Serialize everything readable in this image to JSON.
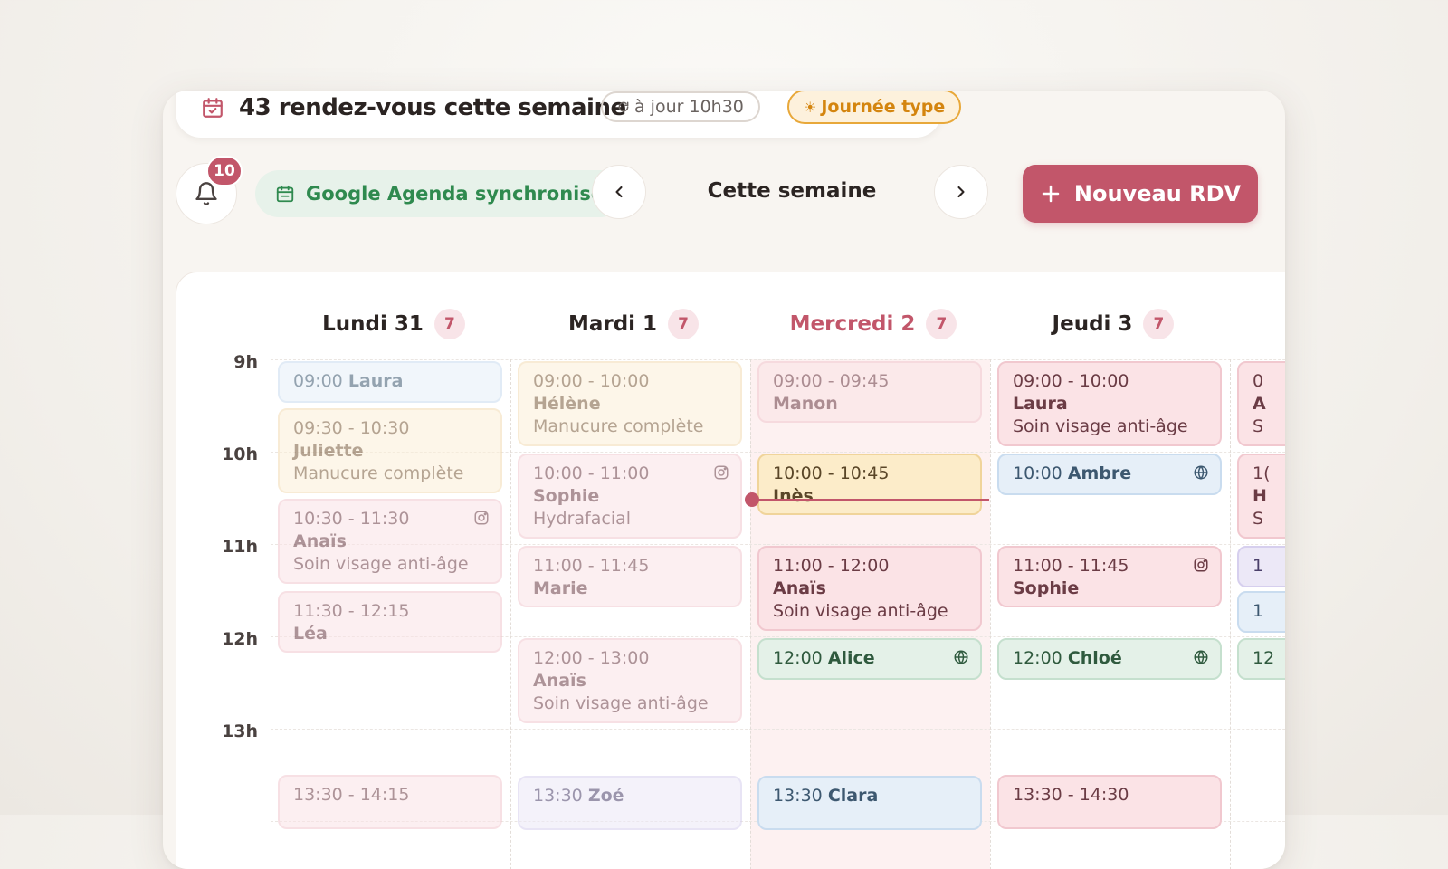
{
  "header": {
    "title": "43 rendez-vous cette semaine",
    "updated": "à jour 10h30",
    "day_type": "Journée type"
  },
  "toolbar": {
    "notifications_count": "10",
    "sync_label": "Google Agenda synchronisé",
    "week_label": "Cette semaine",
    "new_button": "Nouveau RDV"
  },
  "hours": [
    "9h",
    "10h",
    "11h",
    "12h",
    "13h"
  ],
  "days": [
    {
      "label": "Lundi 31",
      "count": "7"
    },
    {
      "label": "Mardi 1",
      "count": "7"
    },
    {
      "label": "Mercredi 2",
      "count": "7"
    },
    {
      "label": "Jeudi 3",
      "count": "7"
    }
  ],
  "events": {
    "mon": [
      {
        "time": "09:00",
        "name": "Laura"
      },
      {
        "time": "09:30 - 10:30",
        "name": "Juliette",
        "service": "Manucure complète"
      },
      {
        "time": "10:30 - 11:30",
        "name": "Anaïs",
        "service": "Soin visage anti-âge",
        "icon": "instagram-icon"
      },
      {
        "time": "11:30 - 12:15",
        "name": "Léa"
      },
      {
        "time": "13:30 - 14:15"
      }
    ],
    "tue": [
      {
        "time": "09:00 - 10:00",
        "name": "Hélène",
        "service": "Manucure complète"
      },
      {
        "time": "10:00 - 11:00",
        "name": "Sophie",
        "service": "Hydrafacial",
        "icon": "instagram-icon"
      },
      {
        "time": "11:00 - 11:45",
        "name": "Marie"
      },
      {
        "time": "12:00 - 13:00",
        "name": "Anaïs",
        "service": "Soin visage anti-âge"
      },
      {
        "time": "13:30",
        "name": "Zoé"
      }
    ],
    "wed": [
      {
        "time": "09:00 - 09:45",
        "name": "Manon"
      },
      {
        "time": "10:00 - 10:45",
        "name": "Inès"
      },
      {
        "time": "11:00 - 12:00",
        "name": "Anaïs",
        "service": "Soin visage anti-âge"
      },
      {
        "time": "12:00",
        "name": "Alice",
        "icon": "globe-icon"
      },
      {
        "time": "13:30",
        "name": "Clara"
      }
    ],
    "thu": [
      {
        "time": "09:00 - 10:00",
        "name": "Laura",
        "service": "Soin visage anti-âge"
      },
      {
        "time": "10:00",
        "name": "Ambre",
        "icon": "globe-icon"
      },
      {
        "time": "11:00 - 11:45",
        "name": "Sophie",
        "icon": "instagram-icon"
      },
      {
        "time": "12:00",
        "name": "Chloé",
        "icon": "globe-icon"
      },
      {
        "time": "13:30 - 14:30"
      }
    ],
    "fri_partial": [
      {
        "time": "0",
        "name": "A",
        "service": "S"
      },
      {
        "time": "1(",
        "name": "H",
        "service": "S"
      },
      {
        "time": "1"
      },
      {
        "time": "1"
      },
      {
        "time": "12"
      }
    ]
  },
  "colors": {
    "accent": "#c2566a",
    "sync_green": "#2f8a4f",
    "day_type_orange": "#d4850f"
  }
}
